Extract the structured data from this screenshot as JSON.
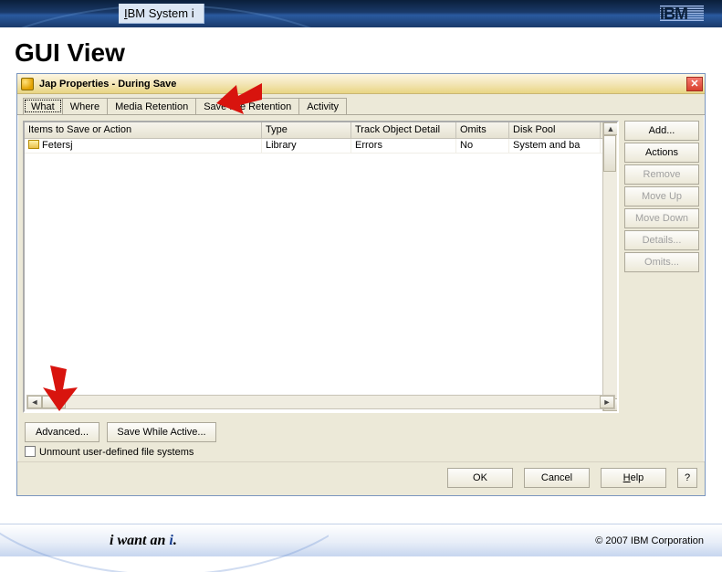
{
  "topbar": {
    "title_pre_u": "I",
    "title_rest": "BM System i",
    "logo": "IBM"
  },
  "heading": "GUI View",
  "dialog": {
    "title": "Jap Properties - During Save",
    "tabs": [
      "What",
      "Where",
      "Media Retention",
      "Save File Retention",
      "Activity"
    ],
    "active_tab": 0,
    "columns": [
      "Items to Save or Action",
      "Type",
      "Track Object Detail",
      "Omits",
      "Disk Pool"
    ],
    "rows": [
      {
        "icon": "folder",
        "item": "Fetersj",
        "type": "Library",
        "track": "Errors",
        "omits": "No",
        "pool": "System and ba"
      }
    ],
    "side_buttons": [
      {
        "label": "Add...",
        "enabled": true
      },
      {
        "label": "Actions",
        "enabled": true
      },
      {
        "label": "Remove",
        "enabled": false
      },
      {
        "label": "Move Up",
        "enabled": false
      },
      {
        "label": "Move Down",
        "enabled": false
      },
      {
        "label": "Details...",
        "enabled": false
      },
      {
        "label": "Omits...",
        "enabled": false
      }
    ],
    "advanced_label": "Advanced...",
    "swa_label": "Save While Active...",
    "unmount_label": "Unmount user-defined file systems",
    "ok_label": "OK",
    "cancel_label": "Cancel",
    "help_label_pre": "",
    "help_hotkey": "H",
    "help_label_post": "elp",
    "qmark": "?"
  },
  "footer": {
    "tag_pre": "i want an ",
    "tag_i": "i",
    "tag_post": ".",
    "copyright": "© 2007 IBM Corporation"
  }
}
